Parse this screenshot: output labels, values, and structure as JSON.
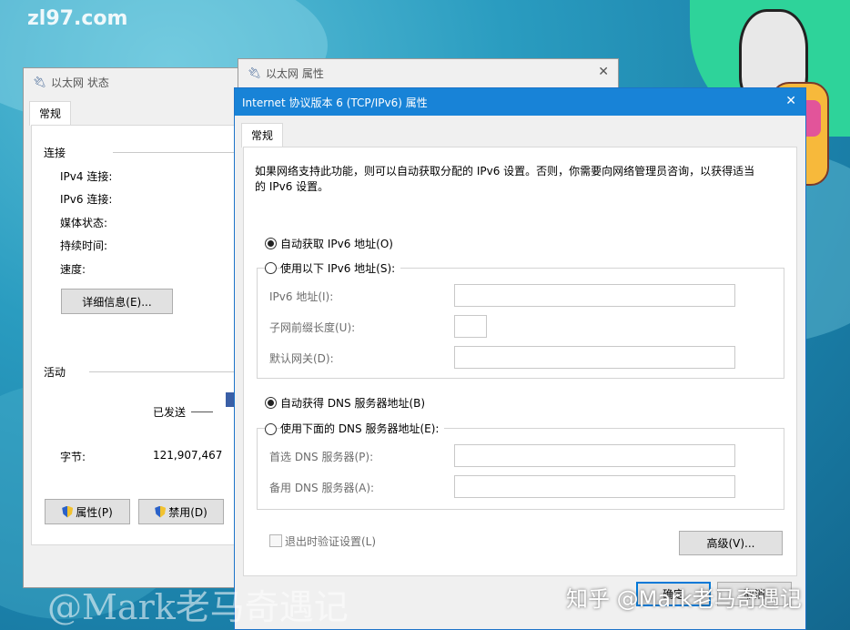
{
  "desktop": {
    "site_watermark": "zl97.com",
    "bottom_left_watermark": "@Mark老马奇遇记",
    "bottom_right_watermark": "知乎 @Mark老马奇遇记"
  },
  "status_window": {
    "title": "以太网 状态",
    "tab": "常规",
    "connection_label": "连接",
    "rows": [
      "IPv4 连接:",
      "IPv6 连接:",
      "媒体状态:",
      "持续时间:",
      "速度:"
    ],
    "details_button": "详细信息(E)...",
    "activity_label": "活动",
    "sent_label": "已发送",
    "bytes_label": "字节:",
    "bytes_sent": "121,907,467",
    "properties_button": "属性(P)",
    "disable_button": "禁用(D)"
  },
  "properties_window": {
    "title": "以太网 属性",
    "close": "✕"
  },
  "ipv6_dialog": {
    "title": "Internet 协议版本 6 (TCP/IPv6) 属性",
    "close": "✕",
    "tab": "常规",
    "description_line1": "如果网络支持此功能，则可以自动获取分配的 IPv6 设置。否则，你需要向网络管理员咨询，以获得适当",
    "description_line2": "的 IPv6 设置。",
    "auto_ip": "自动获取 IPv6 地址(O)",
    "manual_ip": "使用以下 IPv6 地址(S):",
    "ipv6_address": "IPv6 地址(I):",
    "subnet_prefix": "子网前缀长度(U):",
    "gateway": "默认网关(D):",
    "auto_dns": "自动获得 DNS 服务器地址(B)",
    "manual_dns": "使用下面的 DNS 服务器地址(E):",
    "preferred_dns": "首选 DNS 服务器(P):",
    "alternate_dns": "备用 DNS 服务器(A):",
    "validate_on_exit": "退出时验证设置(L)",
    "advanced_button": "高级(V)...",
    "ok_button": "确定",
    "cancel_button": "取消"
  }
}
